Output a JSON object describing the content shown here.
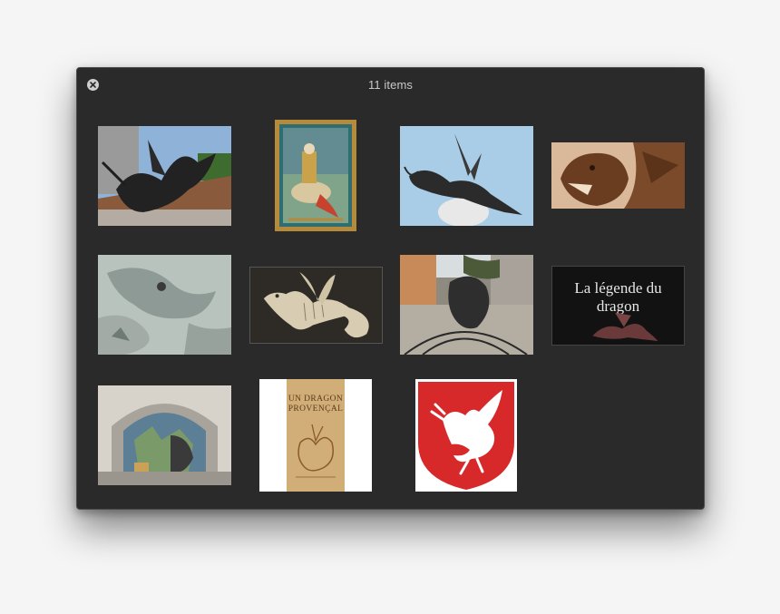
{
  "window": {
    "title": "11 items",
    "close_label": "close-icon"
  },
  "items": [
    {
      "subject": "dragon-sculpture-rooftop"
    },
    {
      "subject": "manuscript-saint-george"
    },
    {
      "subject": "dragon-weathervane"
    },
    {
      "subject": "dragon-head-carving"
    },
    {
      "subject": "dragon-relief-wall"
    },
    {
      "subject": "dragon-engraving"
    },
    {
      "subject": "dragon-sculpture-square"
    },
    {
      "subject": "legende-du-dragon",
      "caption": "La légende du dragon"
    },
    {
      "subject": "dragon-stained-glass-chapel"
    },
    {
      "subject": "book-cover-un-dragon-provencal",
      "book_title_1": "UN DRAGON",
      "book_title_2": "PROVENÇAL"
    },
    {
      "subject": "dragon-coat-of-arms"
    }
  ],
  "colors": {
    "window_bg": "#2b2a2b",
    "page_bg": "#f5f5f5",
    "heraldic_red": "#d7282a"
  }
}
